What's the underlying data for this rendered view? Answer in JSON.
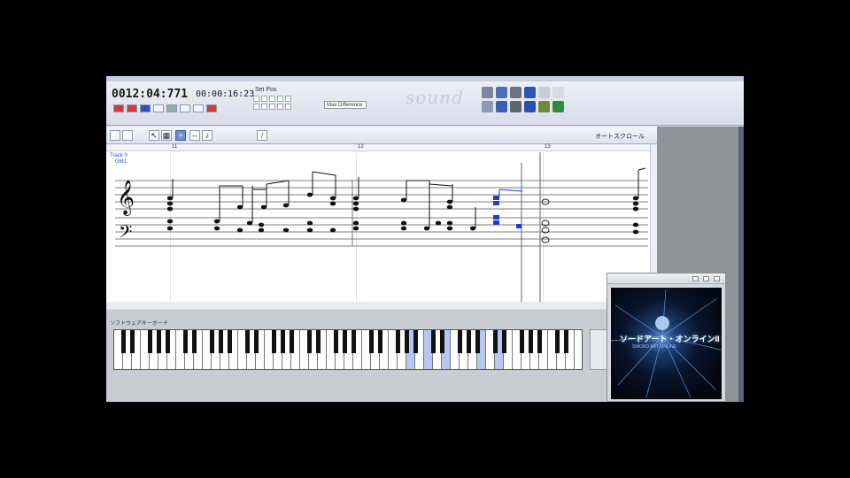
{
  "window": {
    "time_main": "0012:04:771",
    "time_secondary": "00:00:16:23",
    "set_pos_label": "Set Pos",
    "select_text": "Max Difference",
    "logo_text": "sound"
  },
  "score_toolbar": {
    "autoscroll_label": "オートスクロール",
    "track_name": "Track 0",
    "track_sub": "GM1"
  },
  "measures": [
    "11",
    "12",
    "13"
  ],
  "keyboard": {
    "title": "ソフトウェアキーボード"
  },
  "video": {
    "title": "ソードアート・オンラインII",
    "subtitle": "SWORD ART ONLINE"
  },
  "colors": {
    "accent": "#2447c8",
    "highlight_note": "#1a3fd0",
    "pressed_key": "#b8c7f2"
  }
}
